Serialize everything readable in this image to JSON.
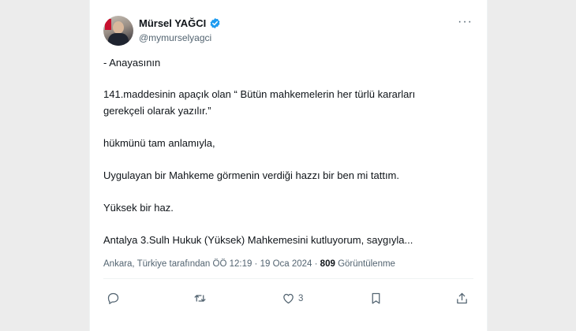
{
  "author": {
    "name": "Mürsel YAĞCI",
    "handle": "@mymurselyagci"
  },
  "tweet": {
    "lines": [
      "- Anayasının",
      "141.maddesinin apaçık olan “ Bütün mahkemelerin her türlü kararları",
      "gerekçeli olarak yazılır.”",
      "hükmünü tam anlamıyla,",
      "Uygulayan bir Mahkeme görmenin verdiği hazzı bir ben mi tattım.",
      "Yüksek bir haz.",
      "Antalya 3.Sulh Hukuk (Yüksek) Mahkemesini kutluyorum, saygıyla..."
    ]
  },
  "meta": {
    "location_time": "Ankara, Türkiye tarafından ÖÖ 12:19 · 19 Oca 2024 ·",
    "views_count": "809",
    "views_label": "Görüntülenme"
  },
  "actions": {
    "like_count": "3"
  },
  "colors": {
    "accent": "#1d9bf0",
    "secondary_text": "#536471",
    "primary_text": "#0f1419"
  }
}
